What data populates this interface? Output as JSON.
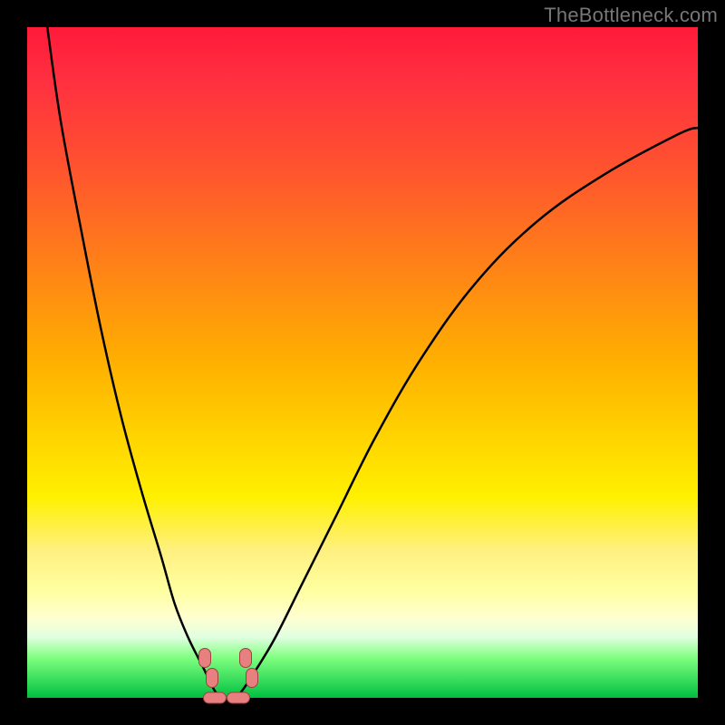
{
  "watermark": "TheBottleneck.com",
  "chart_data": {
    "type": "line",
    "title": "",
    "xlabel": "",
    "ylabel": "",
    "xlim": [
      0,
      100
    ],
    "ylim": [
      0,
      100
    ],
    "background": "rainbow-gradient-vertical",
    "series": [
      {
        "name": "left-curve",
        "x": [
          3,
          5,
          8,
          11,
          14,
          17,
          20,
          22,
          24,
          26,
          27,
          28,
          29
        ],
        "y": [
          100,
          86,
          70,
          55,
          42,
          31,
          21,
          14,
          9,
          5,
          3,
          1,
          0
        ]
      },
      {
        "name": "right-curve",
        "x": [
          31,
          32,
          34,
          37,
          41,
          46,
          52,
          59,
          67,
          76,
          86,
          97,
          100
        ],
        "y": [
          0,
          1,
          4,
          9,
          17,
          27,
          39,
          51,
          62,
          71,
          78,
          84,
          85
        ]
      }
    ],
    "markers": [
      {
        "name": "marker-left-upper",
        "x": 26.5,
        "y": 6
      },
      {
        "name": "marker-left-lower",
        "x": 27.5,
        "y": 3
      },
      {
        "name": "marker-right-upper",
        "x": 32.5,
        "y": 6
      },
      {
        "name": "marker-right-lower",
        "x": 33.5,
        "y": 3
      },
      {
        "name": "marker-bottom-left",
        "x": 28,
        "y": 0,
        "flat": true
      },
      {
        "name": "marker-bottom-right",
        "x": 31.5,
        "y": 0,
        "flat": true
      }
    ]
  }
}
